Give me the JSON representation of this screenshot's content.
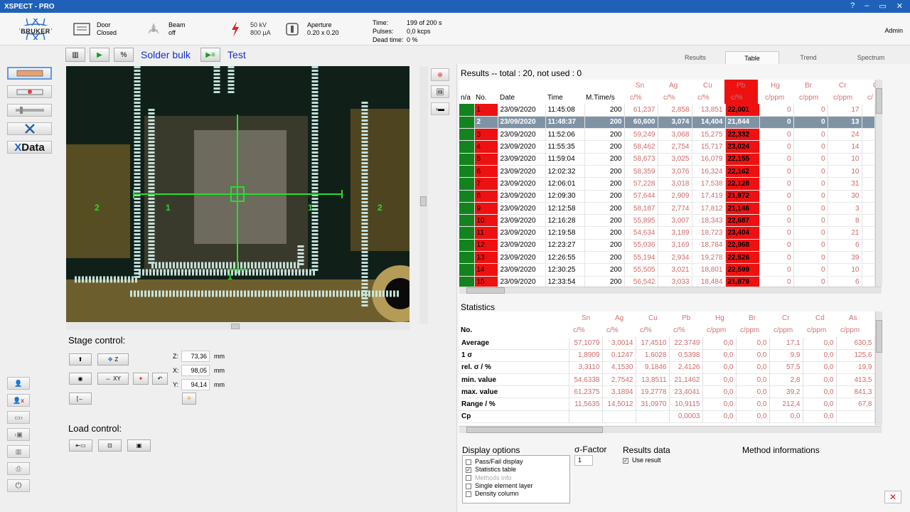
{
  "window": {
    "title": "XSPECT - PRO",
    "controls": [
      "?",
      "–",
      "▭",
      "✕"
    ]
  },
  "header": {
    "logo_text": "BRUKER",
    "door": {
      "label": "Door",
      "value": "Closed"
    },
    "beam": {
      "label": "Beam",
      "value": "off"
    },
    "tube": {
      "kv": "50 kV",
      "ua": "800 µA"
    },
    "aperture": {
      "label": "Aperture",
      "value": "0.20 x  0.20"
    },
    "time": {
      "label": "Time:",
      "value": "199 of 200 s"
    },
    "pulses": {
      "label": "Pulses:",
      "value": "0,0 kcps"
    },
    "dead": {
      "label": "Dead time:",
      "value": "0 %"
    },
    "user": "Admin"
  },
  "sidebar": {
    "xdata_x": "X",
    "xdata_rest": "Data"
  },
  "toolbar": {
    "percent": "%",
    "method": "Solder bulk",
    "sample": "Test"
  },
  "viewer": {
    "labels": [
      "2",
      "1",
      "1",
      "2",
      "1"
    ]
  },
  "stage": {
    "title": "Stage control:",
    "z_btn": "Z",
    "xy_btn": "XY",
    "z_label": "Z:",
    "z_value": "73,36",
    "x_label": "X:",
    "x_value": "98,05",
    "y_label": "Y:",
    "y_value": "94,14",
    "unit": "mm"
  },
  "load": {
    "title": "Load control:"
  },
  "tabs": [
    "Results",
    "Table",
    "Trend",
    "Spectrum"
  ],
  "results": {
    "title": "Results -- total : 20, not used : 0",
    "elements": [
      "Sn",
      "Ag",
      "Cu",
      "Pb",
      "Hg",
      "Br",
      "Cr",
      "C"
    ],
    "units": [
      "c/%",
      "c/%",
      "c/%",
      "c/%",
      "c/ppm",
      "c/ppm",
      "c/ppm",
      "c/"
    ],
    "fixed_headers": [
      "n/a",
      "No.",
      "Date",
      "Time",
      "M.Time/s"
    ],
    "rows": [
      [
        "1",
        "23/09/2020",
        "11:45:08",
        "200",
        "61,237",
        "2,858",
        "13,851",
        "22,001",
        "0",
        "0",
        "17"
      ],
      [
        "2",
        "23/09/2020",
        "11:48:37",
        "200",
        "60,600",
        "3,074",
        "14,404",
        "21,844",
        "0",
        "0",
        "13"
      ],
      [
        "3",
        "23/09/2020",
        "11:52:06",
        "200",
        "59,249",
        "3,068",
        "15,275",
        "22,332",
        "0",
        "0",
        "24"
      ],
      [
        "4",
        "23/09/2020",
        "11:55:35",
        "200",
        "58,462",
        "2,754",
        "15,717",
        "23,024",
        "0",
        "0",
        "14"
      ],
      [
        "5",
        "23/09/2020",
        "11:59:04",
        "200",
        "58,673",
        "3,025",
        "16,079",
        "22,155",
        "0",
        "0",
        "10"
      ],
      [
        "6",
        "23/09/2020",
        "12:02:32",
        "200",
        "58,359",
        "3,076",
        "16,324",
        "22,162",
        "0",
        "0",
        "10"
      ],
      [
        "7",
        "23/09/2020",
        "12:06:01",
        "200",
        "57,228",
        "3,018",
        "17,538",
        "22,128",
        "0",
        "0",
        "31"
      ],
      [
        "8",
        "23/09/2020",
        "12:09:30",
        "200",
        "57,644",
        "2,909",
        "17,419",
        "21,972",
        "0",
        "0",
        "30"
      ],
      [
        "9",
        "23/09/2020",
        "12:12:58",
        "200",
        "58,187",
        "2,774",
        "17,812",
        "21,146",
        "0",
        "0",
        "3"
      ],
      [
        "10",
        "23/09/2020",
        "12:16:28",
        "200",
        "55,895",
        "3,007",
        "18,343",
        "22,687",
        "0",
        "0",
        "8"
      ],
      [
        "11",
        "23/09/2020",
        "12:19:58",
        "200",
        "54,634",
        "3,189",
        "18,723",
        "23,404",
        "0",
        "0",
        "21"
      ],
      [
        "12",
        "23/09/2020",
        "12:23:27",
        "200",
        "55,036",
        "3,169",
        "18,784",
        "22,968",
        "0",
        "0",
        "6"
      ],
      [
        "13",
        "23/09/2020",
        "12:26:55",
        "200",
        "55,194",
        "2,934",
        "19,278",
        "22,526",
        "0",
        "0",
        "39"
      ],
      [
        "14",
        "23/09/2020",
        "12:30:25",
        "200",
        "55,505",
        "3,021",
        "18,801",
        "22,599",
        "0",
        "0",
        "10"
      ],
      [
        "15",
        "23/09/2020",
        "12:33:54",
        "200",
        "56,542",
        "3,033",
        "18,484",
        "21,879",
        "0",
        "0",
        "6"
      ]
    ]
  },
  "statistics": {
    "title": "Statistics",
    "no_label": "No.",
    "elements": [
      "Sn",
      "Ag",
      "Cu",
      "Pb",
      "Hg",
      "Br",
      "Cr",
      "Cd",
      "As"
    ],
    "units": [
      "c/%",
      "c/%",
      "c/%",
      "c/%",
      "c/ppm",
      "c/ppm",
      "c/ppm",
      "c/ppm",
      "c/ppm"
    ],
    "rows": [
      {
        "label": "Average",
        "values": [
          "57,1079",
          "3,0014",
          "17,4510",
          "22,3749",
          "0,0",
          "0,0",
          "17,1",
          "0,0",
          "630,5"
        ]
      },
      {
        "label": "1 σ",
        "values": [
          "1,8909",
          "0,1247",
          "1,6028",
          "0,5398",
          "0,0",
          "0,0",
          "9,9",
          "0,0",
          "125,6"
        ]
      },
      {
        "label": "rel. σ / %",
        "values": [
          "3,3110",
          "4,1530",
          "9,1846",
          "2,4126",
          "0,0",
          "0,0",
          "57,5",
          "0,0",
          "19,9"
        ]
      },
      {
        "label": "min. value",
        "values": [
          "54,6338",
          "2,7542",
          "13,8511",
          "21,1462",
          "0,0",
          "0,0",
          "2,8",
          "0,0",
          "413,5"
        ]
      },
      {
        "label": "max. value",
        "values": [
          "61,2375",
          "3,1894",
          "19,2778",
          "23,4041",
          "0,0",
          "0,0",
          "39,2",
          "0,0",
          "841,3"
        ]
      },
      {
        "label": "Range / %",
        "values": [
          "11,5635",
          "14,5012",
          "31,0970",
          "10,9115",
          "0,0",
          "0,0",
          "212,4",
          "0,0",
          "67,8"
        ]
      },
      {
        "label": "Cp",
        "values": [
          "",
          "",
          "",
          "0,0003",
          "0,0",
          "0,0",
          "0,0",
          "0,0",
          ""
        ]
      }
    ]
  },
  "display_options": {
    "title": "Display options",
    "items": [
      {
        "label": "Pass/Fail display",
        "checked": false,
        "enabled": true
      },
      {
        "label": "Statistics table",
        "checked": true,
        "enabled": true
      },
      {
        "label": "Methods info",
        "checked": false,
        "enabled": false
      },
      {
        "label": "Single element layer",
        "checked": false,
        "enabled": true
      },
      {
        "label": "Density column",
        "checked": false,
        "enabled": true
      }
    ]
  },
  "sigma_factor": {
    "title": "σ-Factor",
    "value": "1"
  },
  "results_data": {
    "title": "Results data",
    "use_result": "Use result"
  },
  "method_info": {
    "title": "Method informations"
  }
}
